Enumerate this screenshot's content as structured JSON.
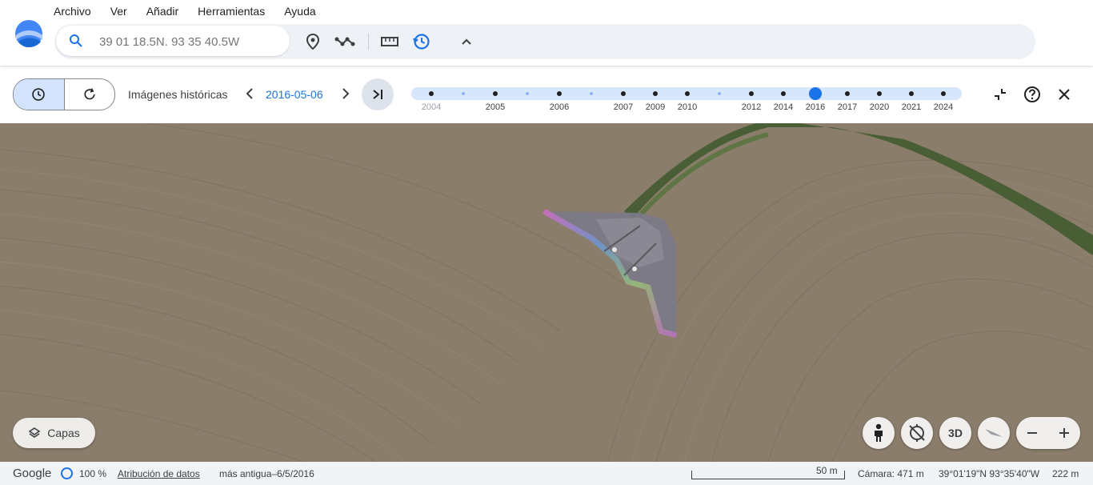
{
  "menu": [
    "Archivo",
    "Ver",
    "Añadir",
    "Herramientas",
    "Ayuda"
  ],
  "search": {
    "placeholder": "39 01 18.5N. 93 35 40.5W"
  },
  "toolbar_icons": [
    "placemark-icon",
    "path-icon",
    "ruler-icon",
    "history-icon",
    "chevron-up-icon"
  ],
  "history": {
    "label": "Imágenes históricas",
    "date": "2016-05-06",
    "ticks": [
      {
        "label": "2004",
        "major": true,
        "faded": true
      },
      {
        "label": "",
        "major": false
      },
      {
        "label": "2005",
        "major": true
      },
      {
        "label": "",
        "major": false
      },
      {
        "label": "2006",
        "major": true
      },
      {
        "label": "",
        "major": false
      },
      {
        "label": "2007",
        "major": true
      },
      {
        "label": "2009",
        "major": true
      },
      {
        "label": "2010",
        "major": true
      },
      {
        "label": "",
        "major": false
      },
      {
        "label": "2012",
        "major": true
      },
      {
        "label": "2014",
        "major": true
      },
      {
        "label": "2016",
        "major": true,
        "selected": true
      },
      {
        "label": "2017",
        "major": true
      },
      {
        "label": "2020",
        "major": true
      },
      {
        "label": "2021",
        "major": true
      },
      {
        "label": "2024",
        "major": true
      }
    ]
  },
  "map": {
    "layers_label": "Capas",
    "view_3d_label": "3D"
  },
  "status": {
    "brand": "Google",
    "zoom": "100 %",
    "attribution": "Atribución de datos",
    "oldest": "más antigua–6/5/2016",
    "scale": "50 m",
    "camera": "Cámara: 471 m",
    "coords": "39°01'19\"N 93°35'40\"W",
    "elevation": "222 m"
  },
  "colors": {
    "accent": "#1a73e8",
    "timeline": "#d8e6fb",
    "field": "#8b7d6b"
  }
}
